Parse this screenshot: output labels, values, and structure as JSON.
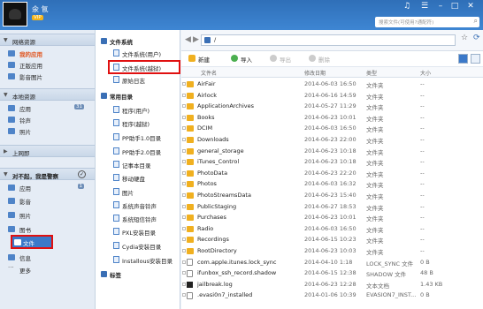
{
  "header": {
    "username": "氽 氜",
    "vip": "VIP",
    "search_placeholder": "搜索文件(可使用?通配符)"
  },
  "colors": {
    "titlebar": "#3e86d3",
    "selected": "#3b79c9",
    "highlight": "#e01010"
  },
  "sidebar": {
    "sections": [
      {
        "label": "网络资源",
        "items": [
          {
            "label": "我的应用",
            "hl": true
          },
          {
            "label": "正版应用"
          },
          {
            "label": "影音图片"
          }
        ]
      },
      {
        "label": "本地资源",
        "items": [
          {
            "label": "应用",
            "count": "31"
          },
          {
            "label": "铃声"
          },
          {
            "label": "照片"
          }
        ]
      },
      {
        "label": "上网即",
        "items": []
      },
      {
        "label": "对不起，我是警察",
        "items": [
          {
            "label": "应用",
            "count": "1"
          },
          {
            "label": "影音"
          },
          {
            "label": "照片"
          },
          {
            "label": "图书"
          },
          {
            "label": "文件",
            "selected": true
          },
          {
            "label": "信息"
          },
          {
            "label": "更多"
          }
        ]
      }
    ]
  },
  "midpanel": {
    "group1_title": "文件系统",
    "group1_items": [
      "文件系统(用户)",
      "文件系统(越狱)",
      "原始日志"
    ],
    "group2_title": "常用目录",
    "group2_items": [
      "程序(用户)",
      "程序(越狱)",
      "PP助手1.0目录",
      "PP助手2.0目录",
      "记事本目录",
      "移动硬盘",
      "图片",
      "系统声音铃声",
      "系统短信铃声",
      "PXL安装目录",
      "Cydia安装目录",
      "Installous安装目录"
    ],
    "group3_title": "标签"
  },
  "toolbar": {
    "path": "/",
    "new": "新建",
    "import": "导入",
    "export": "导出",
    "delete": "删除"
  },
  "columns": {
    "name": "文件名",
    "date": "修改日期",
    "type": "类型",
    "size": "大小"
  },
  "files": [
    {
      "name": "AirFair",
      "date": "2014-06-03 16:50",
      "type": "文件夹",
      "size": "--",
      "icon": "folder"
    },
    {
      "name": "Airlock",
      "date": "2014-06-16 14:59",
      "type": "文件夹",
      "size": "--",
      "icon": "folder"
    },
    {
      "name": "ApplicationArchives",
      "date": "2014-05-27 11:29",
      "type": "文件夹",
      "size": "--",
      "icon": "folder"
    },
    {
      "name": "Books",
      "date": "2014-06-23 10:01",
      "type": "文件夹",
      "size": "--",
      "icon": "folder"
    },
    {
      "name": "DCIM",
      "date": "2014-06-03 16:50",
      "type": "文件夹",
      "size": "--",
      "icon": "folder"
    },
    {
      "name": "Downloads",
      "date": "2014-06-23 22:00",
      "type": "文件夹",
      "size": "--",
      "icon": "folder"
    },
    {
      "name": "general_storage",
      "date": "2014-06-23 10:18",
      "type": "文件夹",
      "size": "--",
      "icon": "folder"
    },
    {
      "name": "iTunes_Control",
      "date": "2014-06-23 10:18",
      "type": "文件夹",
      "size": "--",
      "icon": "folder"
    },
    {
      "name": "PhotoData",
      "date": "2014-06-23 22:20",
      "type": "文件夹",
      "size": "--",
      "icon": "folder"
    },
    {
      "name": "Photos",
      "date": "2014-06-03 16:32",
      "type": "文件夹",
      "size": "--",
      "icon": "folder"
    },
    {
      "name": "PhotoStreamsData",
      "date": "2014-06-23 15:40",
      "type": "文件夹",
      "size": "--",
      "icon": "folder"
    },
    {
      "name": "PublicStaging",
      "date": "2014-06-27 18:53",
      "type": "文件夹",
      "size": "--",
      "icon": "folder"
    },
    {
      "name": "Purchases",
      "date": "2014-06-23 10:01",
      "type": "文件夹",
      "size": "--",
      "icon": "folder"
    },
    {
      "name": "Radio",
      "date": "2014-06-03 16:50",
      "type": "文件夹",
      "size": "--",
      "icon": "folder"
    },
    {
      "name": "Recordings",
      "date": "2014-06-15 10:23",
      "type": "文件夹",
      "size": "--",
      "icon": "folder"
    },
    {
      "name": "RootDirectory",
      "date": "2014-06-23 10:03",
      "type": "文件夹",
      "size": "--",
      "icon": "folder"
    },
    {
      "name": "com.apple.itunes.lock_sync",
      "date": "2014-04-10 1:18",
      "type": "LOCK_SYNC 文件",
      "size": "0 B",
      "icon": "doc"
    },
    {
      "name": "ifunbox_ssh_record.shadow",
      "date": "2014-06-15 12:38",
      "type": "SHADOW 文件",
      "size": "48 B",
      "icon": "doc"
    },
    {
      "name": "jailbreak.log",
      "date": "2014-06-23 12:28",
      "type": "文本文档",
      "size": "1.43 KB",
      "icon": "sq"
    },
    {
      "name": ".evasi0n7_installed",
      "date": "2014-01-06 10:39",
      "type": "EVASION7_INST...",
      "size": "0 B",
      "icon": "doc"
    }
  ]
}
